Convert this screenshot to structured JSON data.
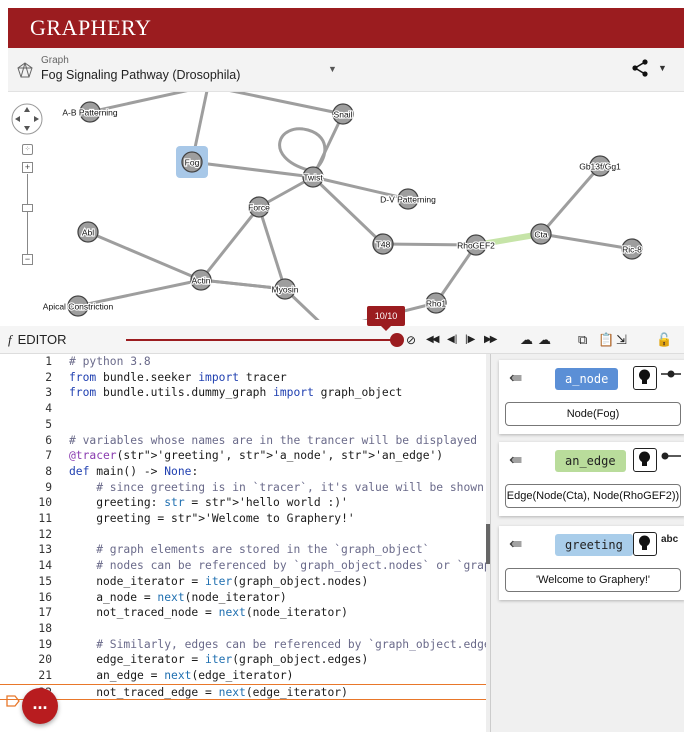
{
  "app": {
    "title": "GRAPHERY"
  },
  "graph_select": {
    "label": "Graph",
    "value": "Fog Signaling Pathway (Drosophila)"
  },
  "graph": {
    "nodes": [
      {
        "id": "A-B Patterning"
      },
      {
        "id": "Fog"
      },
      {
        "id": "Snail"
      },
      {
        "id": "Twist"
      },
      {
        "id": "D-V Patterning"
      },
      {
        "id": "Force"
      },
      {
        "id": "Abl"
      },
      {
        "id": "Actin"
      },
      {
        "id": "Myosin"
      },
      {
        "id": "T48"
      },
      {
        "id": "RhoGEF2"
      },
      {
        "id": "Cta"
      },
      {
        "id": "Gb13f/Gg1"
      },
      {
        "id": "Ric-8"
      },
      {
        "id": "Rho1"
      },
      {
        "id": "Apical Constriction"
      }
    ],
    "highlighted_node": "Fog",
    "highlighted_edge": [
      "Cta",
      "RhoGEF2"
    ],
    "colors": {
      "node": "#9e9e9e",
      "edge": "#9e9e9e",
      "node_highlight": "#a8c8e8",
      "edge_highlight": "#c6e4a8"
    }
  },
  "editor": {
    "title": "EDITOR",
    "step_label": "10/10",
    "current_line": 22,
    "lines": [
      "# python 3.8",
      "from bundle.seeker import tracer",
      "from bundle.utils.dummy_graph import graph_object",
      "",
      "",
      "# variables whose names are in the trancer will be displayed",
      "@tracer('greeting', 'a_node', 'an_edge')",
      "def main() -> None:",
      "    # since greeting is in `tracer`, it's value will be shown",
      "    greeting: str = 'hello world :)'",
      "    greeting = 'Welcome to Graphery!'",
      "",
      "    # graph elements are stored in the `graph_object`",
      "    # nodes can be referenced by `graph_object.nodes` or `graph_",
      "    node_iterator = iter(graph_object.nodes)",
      "    a_node = next(node_iterator)",
      "    not_traced_node = next(node_iterator)",
      "",
      "    # Similarly, edges can be referenced by `graph_object.edges`",
      "    edge_iterator = iter(graph_object.edges)",
      "    an_edge = next(edge_iterator)",
      "    not_traced_edge = next(edge_iterator)"
    ]
  },
  "variables": [
    {
      "name": "a_node",
      "value": "Node(Fog)",
      "color": "#5b8fd6",
      "text_color": "#ffffff",
      "kind": "node"
    },
    {
      "name": "an_edge",
      "value": "Edge(Node(Cta), Node(RhoGEF2))",
      "color": "#b9dc9b",
      "text_color": "#222222",
      "kind": "edge"
    },
    {
      "name": "greeting",
      "value": "'Welcome to Graphery!'",
      "color": "#a9cdea",
      "text_color": "#222222",
      "kind": "abc"
    }
  ],
  "fab": {
    "label": "..."
  },
  "kind_labels": {
    "abc": "abc"
  }
}
